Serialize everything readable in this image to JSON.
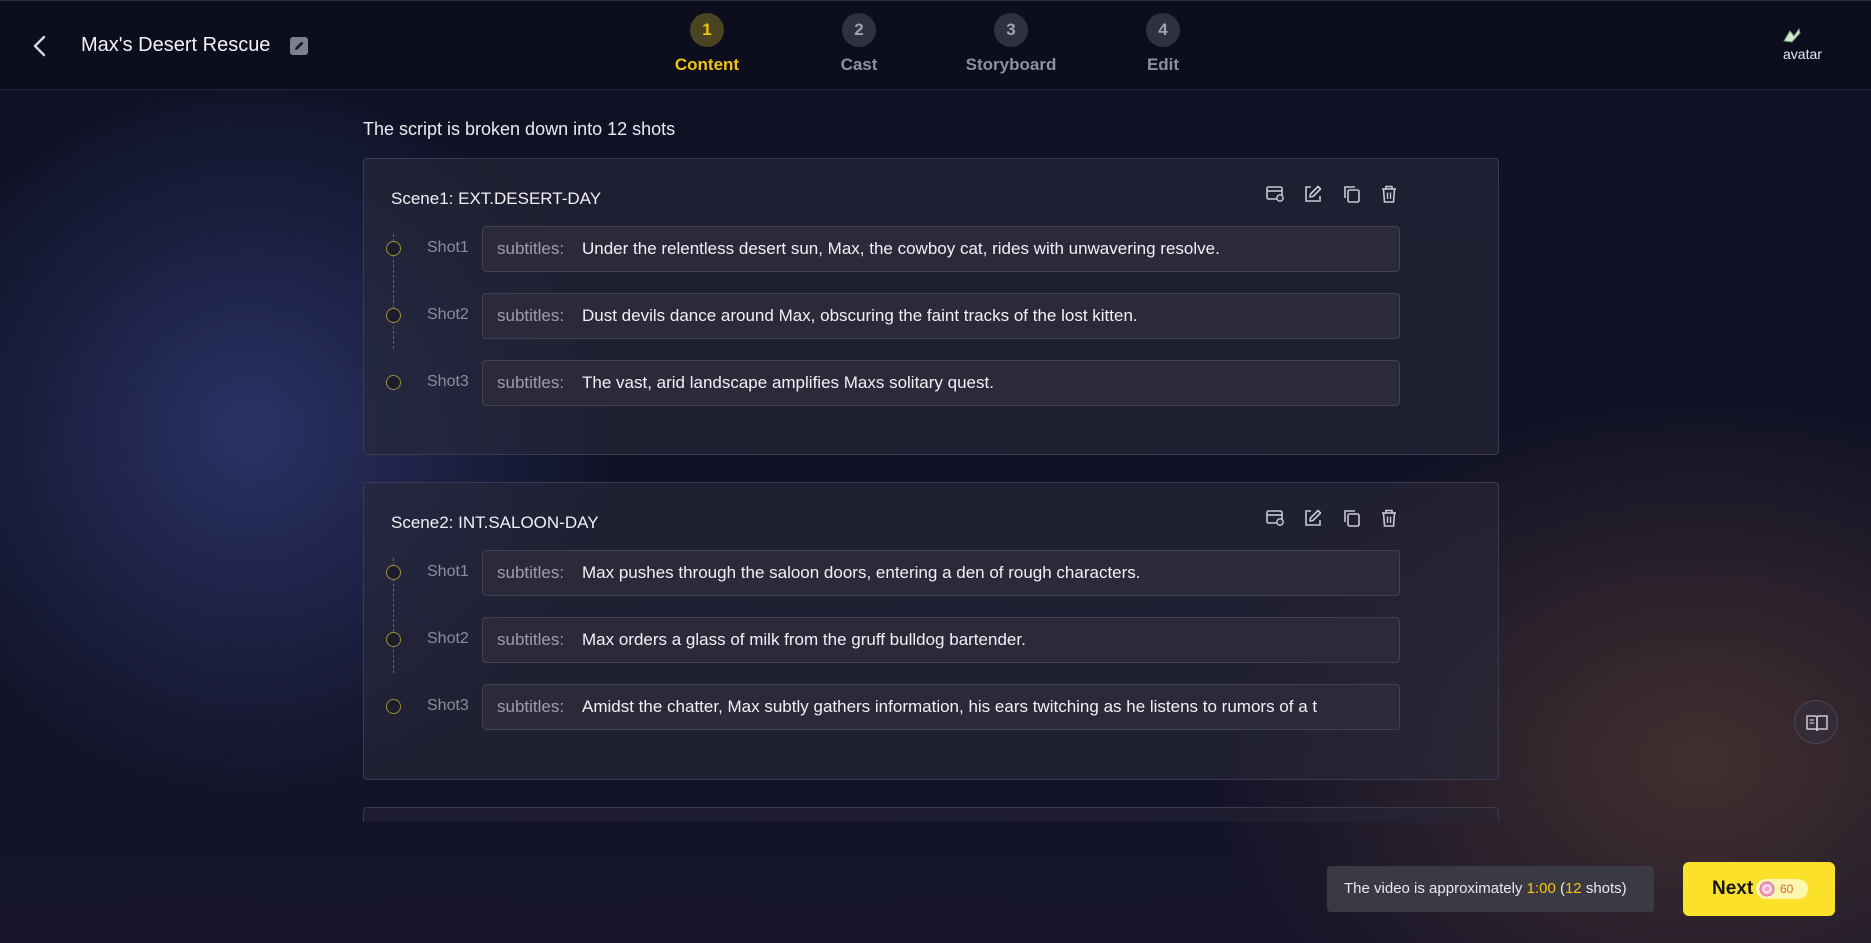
{
  "header": {
    "project_title": "Max's Desert Rescue",
    "steps": [
      {
        "num": "1",
        "label": "Content",
        "active": true
      },
      {
        "num": "2",
        "label": "Cast",
        "active": false
      },
      {
        "num": "3",
        "label": "Storyboard",
        "active": false
      },
      {
        "num": "4",
        "label": "Edit",
        "active": false
      }
    ],
    "avatar_alt": "avatar"
  },
  "summary": "The script is broken down into 12 shots",
  "subtitle_key": "subtitles:",
  "scenes": [
    {
      "title": "Scene1: EXT.DESERT-DAY",
      "shots": [
        {
          "label": "Shot1",
          "subtitle": "Under the relentless desert sun, Max, the cowboy cat, rides with unwavering resolve."
        },
        {
          "label": "Shot2",
          "subtitle": "Dust devils dance around Max, obscuring the faint tracks of the lost kitten."
        },
        {
          "label": "Shot3",
          "subtitle": "The vast, arid landscape amplifies Maxs solitary quest."
        }
      ]
    },
    {
      "title": "Scene2: INT.SALOON-DAY",
      "shots": [
        {
          "label": "Shot1",
          "subtitle": "Max pushes through the saloon doors, entering a den of rough characters."
        },
        {
          "label": "Shot2",
          "subtitle": "Max orders a glass of milk from the gruff bulldog bartender."
        },
        {
          "label": "Shot3",
          "subtitle": "Amidst the chatter, Max subtly gathers information, his ears twitching as he listens to rumors of a t"
        }
      ]
    }
  ],
  "footer": {
    "duration_prefix": "The video is approximately ",
    "duration_value": "1:00",
    "duration_open": " (",
    "shot_count": "12",
    "duration_suffix": " shots)",
    "next_label": "Next",
    "credits": "60"
  },
  "colors": {
    "accent": "#f1c40f",
    "next_button": "#fbe12a"
  },
  "icons": [
    "back-arrow-icon",
    "edit-title-icon",
    "storyboard-icon",
    "edit-icon",
    "copy-icon",
    "delete-icon",
    "book-icon",
    "coin-icon"
  ]
}
